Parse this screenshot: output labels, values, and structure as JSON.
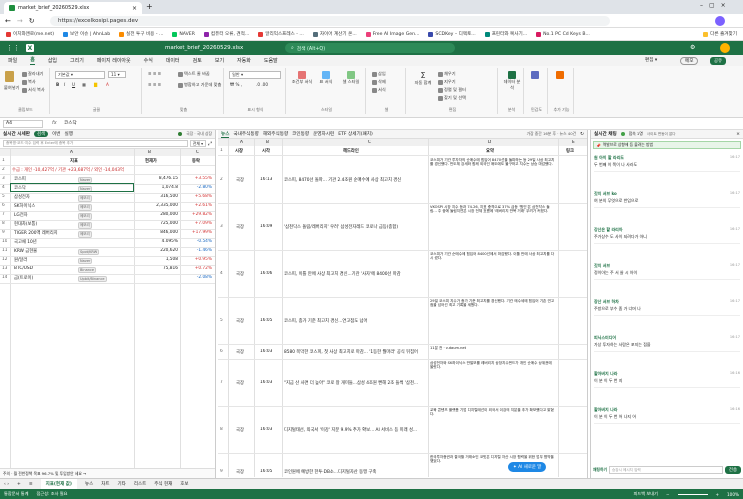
{
  "browser": {
    "tab_title": "market_brief_20260529.xlsx",
    "url": "https://excelkosipi.pages.dev",
    "bookmarks": [
      "이치와앤로(me.net)",
      "보안 이슈 | AhnLab",
      "실전 투구 비용 - ...",
      "NAVER",
      "컴퓨터 오류, 견적...",
      "알리익스프레스 - ...",
      "자이어 계산기 온...",
      "Free AI Image Gen...",
      "SCDKey – 디렉토...",
      "프린터와 복사기...",
      "No.1 PC Cd Keys B..."
    ],
    "bookmarks_folder": "다른 즐겨찾기"
  },
  "app": {
    "filename": "market_brief_20260529.xlsx",
    "search_placeholder": "검색 (Alt+Q)",
    "menu_tabs": [
      "파일",
      "홈",
      "삽입",
      "그리기",
      "페이지 레이아웃",
      "수식",
      "데이터",
      "검토",
      "보기",
      "자동화",
      "도움말"
    ],
    "active_tab": "홈",
    "edit_label": "편집",
    "share_label": "공유",
    "comments_label": "메모",
    "ribbon": {
      "clipboard": {
        "paste": "붙여넣기",
        "cut": "잘라내기",
        "copy": "복사",
        "format_painter": "서식 복사",
        "label": "클립보드"
      },
      "font": {
        "name": "기본값",
        "size": "11",
        "label": "글꼴"
      },
      "alignment": {
        "wrap": "텍스트 줄 바꿈",
        "merge": "병합하고 가운데 맞춤",
        "label": "맞춤"
      },
      "number": {
        "format": "일반",
        "label": "표시 형식"
      },
      "styles": {
        "conditional": "조건부 서식",
        "table": "표 서식",
        "cell_styles": "셀 스타일",
        "label": "스타일"
      },
      "cells": {
        "insert": "삽입",
        "delete": "삭제",
        "format": "서식",
        "label": "셀"
      },
      "editing": {
        "sum": "자동 합계",
        "fill": "채우기",
        "clear": "지우기",
        "sort": "정렬 및 필터",
        "find": "찾기 및 선택",
        "label": "편집"
      },
      "analysis": {
        "analyze": "데이터 분석",
        "label": "분석"
      },
      "sensitivity": {
        "label": "민감도"
      },
      "addins": {
        "label": "추가 기능"
      }
    },
    "cell_ref": "A4",
    "formula_value": "코스닥"
  },
  "left_panel": {
    "title": "실시간 시세판",
    "tabs": [
      "검색",
      "이번",
      "실행"
    ],
    "status": "국장 · 국내 상장",
    "search_placeholder": "종목명·코드·지수 입력 후 Enter에 종목 추가",
    "filter_label": "전체",
    "columns": [
      "A",
      "B",
      "C"
    ],
    "headers": [
      "지표",
      "현재가",
      "등락"
    ],
    "summary_row": "수급 : 개인 -10,427억 / 기관 +23,687억 / 외인 -14,043억",
    "rows": [
      {
        "num": "3",
        "name": "코스피",
        "tag": "Naver",
        "price": "8,476.15",
        "change": "+3.55%",
        "dir": "pos"
      },
      {
        "num": "4",
        "name": "코스닥",
        "tag": "Naver",
        "price": "1,074.8",
        "change": "-2.80%",
        "dir": "neg"
      },
      {
        "num": "5",
        "name": "삼성전자",
        "tag": "메모리",
        "price": "316,500",
        "change": "+5.68%",
        "dir": "pos"
      },
      {
        "num": "6",
        "name": "SK하이닉스",
        "tag": "메모리",
        "price": "2,335,000",
        "change": "+2.61%",
        "dir": "pos"
      },
      {
        "num": "7",
        "name": "LG전자",
        "tag": "메모리",
        "price": "280,000",
        "change": "+29.82%",
        "dir": "pos"
      },
      {
        "num": "8",
        "name": "현대차(보통)",
        "tag": "메모리",
        "price": "725,000",
        "change": "+7.09%",
        "dir": "pos"
      },
      {
        "num": "9",
        "name": "TIGER 200액 레버리지",
        "tag": "메모리",
        "price": "846,000",
        "change": "+17.99%",
        "dir": "pos"
      },
      {
        "num": "10",
        "name": "국고채 10년",
        "tag": "",
        "price": "4.095%",
        "change": "-0.54%",
        "dir": "neg"
      },
      {
        "num": "11",
        "name": "KRW 금현물",
        "tag": "Spot/KRW",
        "price": "220,620",
        "change": "-1.46%",
        "dir": "neg"
      },
      {
        "num": "12",
        "name": "원/달러",
        "tag": "Naver",
        "price": "1,508",
        "change": "+0.95%",
        "dir": "pos"
      },
      {
        "num": "13",
        "name": "BTC/USD",
        "tag": "Binance",
        "price": "75,816",
        "change": "+0.72%",
        "dir": "pos"
      },
      {
        "num": "14",
        "name": "금(트로이)",
        "tag": "Upbit/Binance",
        "price": "",
        "change": "-2.08%",
        "dir": "neg"
      }
    ],
    "footer": "주의 · 월 전반정책 목표 96.7% 및 투입방안 세요 →"
  },
  "news_panel": {
    "tabs": [
      "뉴스",
      "국내주식동향",
      "해외주식동향",
      "코인동향",
      "운영자시련",
      "ETF 상세기(패치)"
    ],
    "info": "가장 중간 16분 후 · 뉴스 40건",
    "columns": [
      "A",
      "B",
      "C",
      "D",
      "E"
    ],
    "headers": [
      "시장",
      "시각",
      "헤드라인",
      "요약",
      "링크"
    ],
    "rows": [
      {
        "num": "2",
        "market": "국장",
        "time": "16:13",
        "headline": "코스피, 8470선 돌파... 기관 2.4조원 순매수에 사상 최고치 경신",
        "summary": "코스피가 기관 투자자의 순매수에 힘입어 8470선을 돌파하는 등 29일 사상 최고치를 경신했다. 반도체 강세와 함께 외국인 매도에도 불구하고 지수는 상승 마감했다."
      },
      {
        "num": "3",
        "market": "국장",
        "time": "16:09",
        "headline": "'삼천닥스 돌림/레버리지' 우려' 삼성전자레드 코로나 급등(종합)",
        "summary": "VKOSPI 시장 지수 등과 74.26, 지표 충격으로 37% 급등 '원인'은 삼천닥스 돌림... 주 중에 돌림지연은 시장 전체 흐름에 '레버리지 반복 거래' 우려가 커졌다."
      },
      {
        "num": "4",
        "market": "국장",
        "time": "16:06",
        "headline": "코스피, 이틀 만에 사상 최고치 경신...기관 '사자'에 8400선 마감",
        "summary": "코스피가 기관 순매수에 힘입어 8400선에서 마감했다. 이틀 만에 사상 최고치를 다시 썼다."
      },
      {
        "num": "5",
        "market": "국장",
        "time": "16:05",
        "headline": "코스피, 종가 기준 최고치 경신...연고점도 넘어",
        "summary": "29일 코스피 지수가 종가 기준 최고치를 경신했다. 기관 매수세에 힘입어 기존 연고점을 넘어선 최고 기록을 세웠다."
      },
      {
        "num": "6",
        "market": "국장",
        "time": "16:03",
        "headline": "8580 목막한 코스피, 첫 사상 최고치로 마감... '1등한 월마라' 공식 뒤집어",
        "summary": "11분 전 · v.daum.net"
      },
      {
        "num": "7",
        "market": "국장",
        "time": "16:03",
        "headline": "\"지금 산 사면 더 높아\" 코로 왕 개미들...삼성 4조원 빤해 2조 들썩 '삼천...",
        "summary": "삼성전자와 SK하이닉스 반발모를 레버리지 상장지수펀드가 개인 순매수 상위권에 올랐다."
      },
      {
        "num": "8",
        "market": "국장",
        "time": "16:03",
        "headline": "디지털태선, 외국서 '이강' 지분 9.9% 추가 확보... AI 서비스 등 미래 성...",
        "summary": "교육 콘텐츠 플랫폼 기업 디지털태선이 외국서 이강의 지분을 추가 확보했다고 밝혔다."
      },
      {
        "num": "9",
        "market": "국장",
        "time": "16:05",
        "headline": "코인원에 예방한 한투·DB소...디지털자산 동맹 구축",
        "summary": "한국투자증권과 결국할 거래소인 코빗은 디지털 자산 시장 협력을 위한 업무 협약을 맺었다."
      }
    ],
    "chat_button": "AI 새로운 말"
  },
  "right_panel": {
    "title": "실시간 채팅",
    "status": "접속 1명",
    "online": "사이트 변동이 없다",
    "notice": "역발브로 상향에 등 물려는 방법",
    "messages": [
      {
        "user": "원 아이 할 라리도",
        "time": "16:17",
        "text": "두 번째 이 쪽이 나 사라도"
      },
      {
        "user": "갓지 서브 ko",
        "time": "16:17",
        "text": "여 분의 무엇으로 반입으로"
      },
      {
        "user": "강산은 할 라리아",
        "time": "16:17",
        "text": "주가상수 도 사이 되려다가 아니"
      },
      {
        "user": "갓지 서브",
        "time": "16:17",
        "text": "정이아는 주 서 쓸 시 아이"
      },
      {
        "user": "장산 서브 하차",
        "time": "16:17",
        "text": "주방으로 부수 좀 가 너머 나"
      },
      {
        "user": "피닉스미디어",
        "time": "16:17",
        "text": "가상 투자하는 사람은 포지는 점을"
      },
      {
        "user": "할아버지 나라",
        "time": "16:16",
        "text": "이 분 이 두 번 지"
      },
      {
        "user": "할아버지 나라",
        "time": "16:16",
        "text": "이 분 이 두 번 어 나지 어"
      }
    ],
    "input_label": "채팅하기",
    "input_placeholder": "승강시 메시지 입력",
    "send_label": "전송"
  },
  "statusbar": {
    "sheet_tabs": [
      "지표(현재 값)",
      "뉴스",
      "차트",
      "기타",
      "리스트",
      "주식 현재",
      "호보"
    ],
    "active_sheet": "지표(현재 값)",
    "status_items": [
      "통합문서 통계",
      "접근성: 조사 필요",
      "피드백 보내기"
    ],
    "zoom": "100%"
  }
}
